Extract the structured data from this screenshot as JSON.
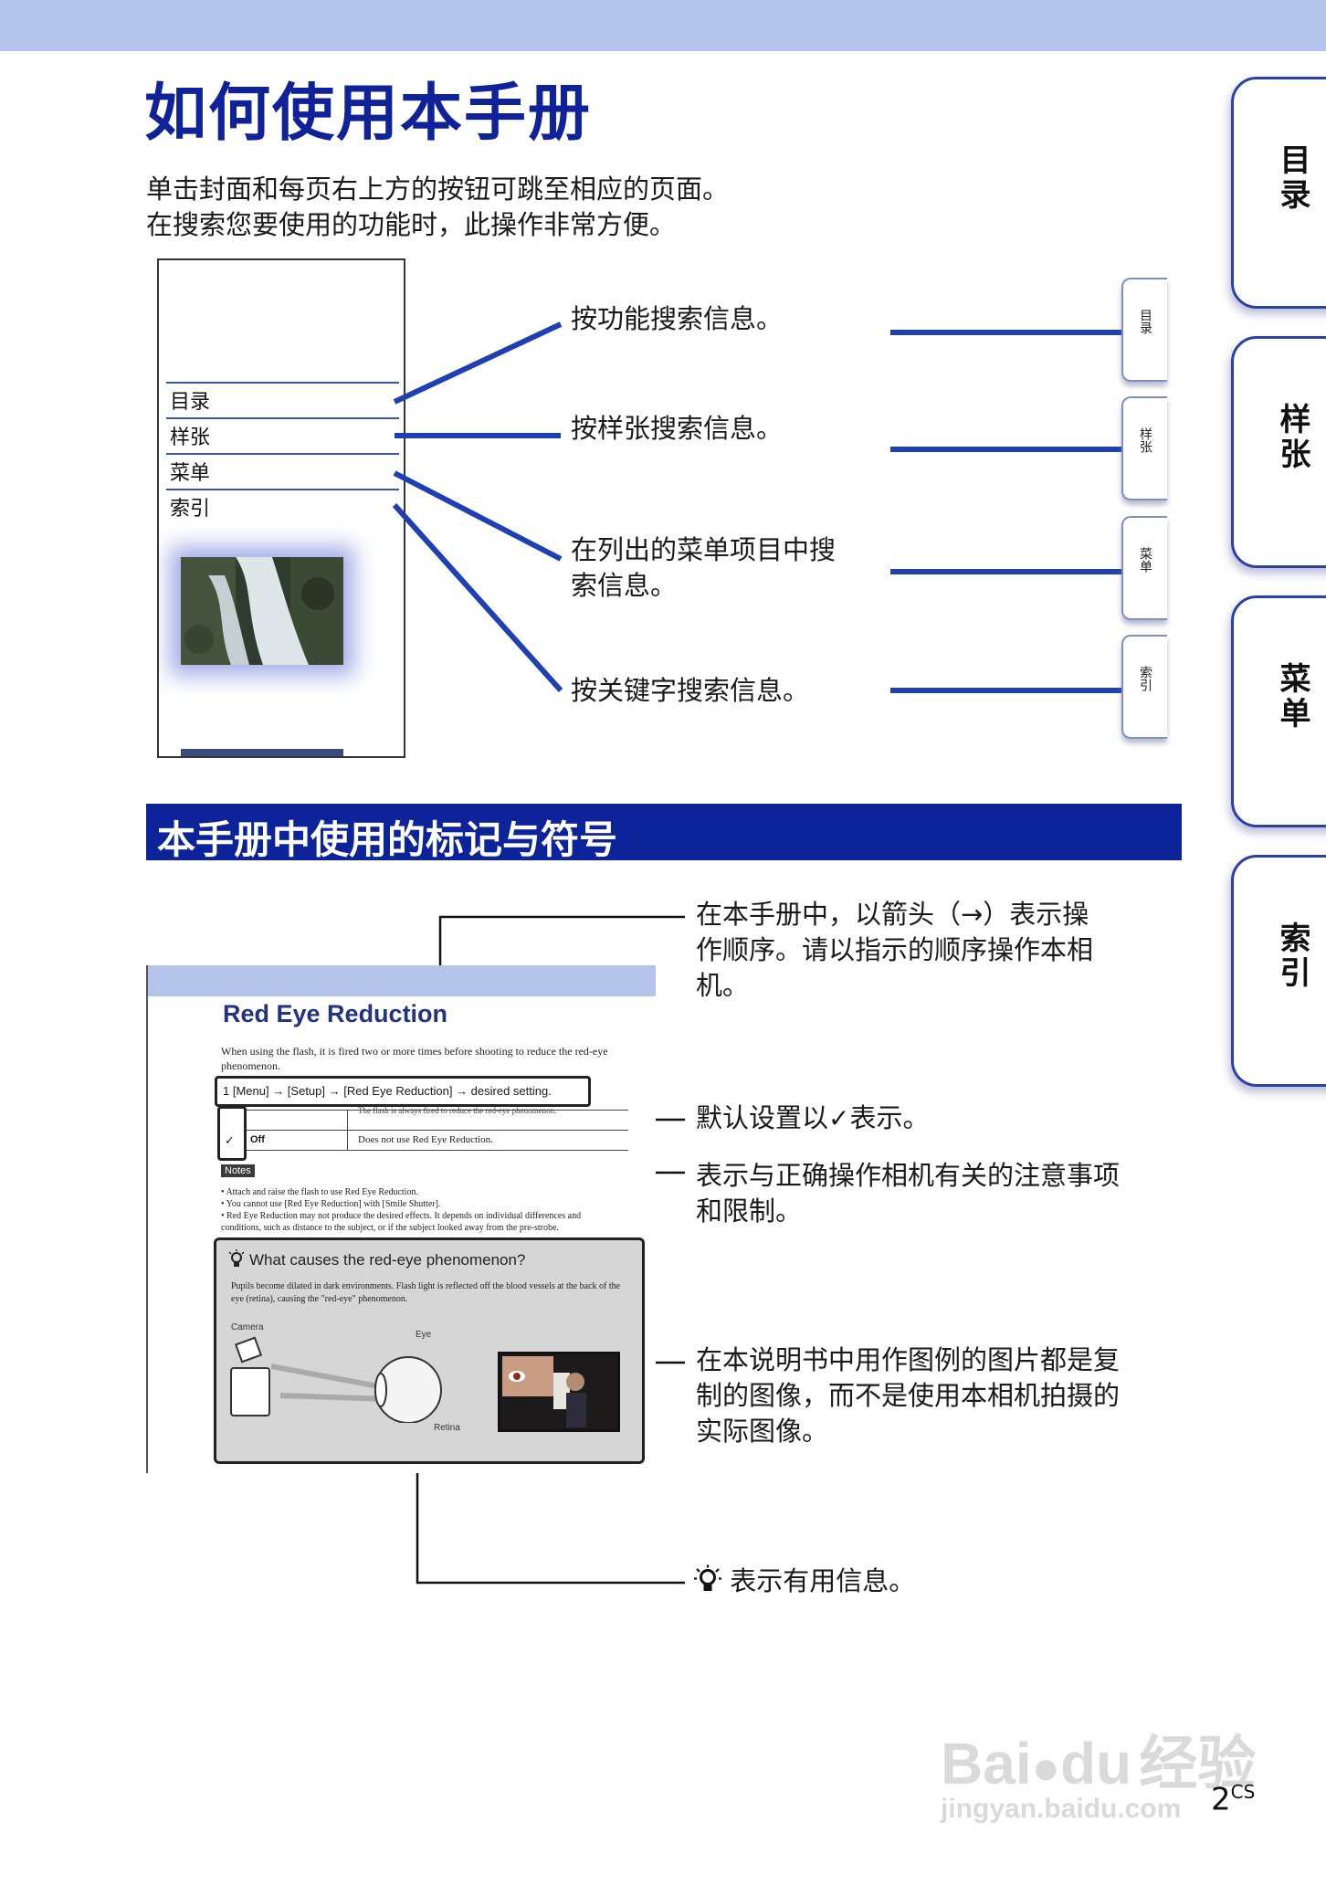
{
  "page": {
    "title": "如何使用本手册",
    "intro": [
      "单击封面和每页右上方的按钮可跳至相应的页面。",
      "在搜索您要使用的功能时，此操作非常方便。"
    ],
    "number": "2",
    "number_suffix": "CS"
  },
  "side_tabs": [
    "目录",
    "样张",
    "菜单",
    "索引"
  ],
  "diagram": {
    "page_items": [
      "目录",
      "样张",
      "菜单",
      "索引"
    ],
    "callouts": [
      "按功能搜索信息。",
      "按样张搜索信息。",
      "在列出的菜单项目中搜",
      "索信息。",
      "按关键字搜索信息。"
    ],
    "mini_tabs": [
      "目录",
      "样张",
      "菜单",
      "索引"
    ]
  },
  "section": {
    "title": "本手册中使用的标记与符号"
  },
  "sample_page": {
    "title": "Red Eye Reduction",
    "description": "When using the flash, it is fired two or more times before shooting to reduce the red-eye phenomenon.",
    "step": "1  [Menu] → [Setup] → [Red Eye Reduction] → desired setting.",
    "table_row1": "The flash is always fired to reduce the red-eye phenomenon.",
    "table_row2_key": "Off",
    "table_row2_value": "Does not use Red Eye Reduction.",
    "notes_badge": "Notes",
    "notes": [
      "• Attach and raise the flash to use Red Eye Reduction.",
      "• You cannot use [Red Eye Reduction] with [Smile Shutter].",
      "• Red Eye Reduction may not produce the desired effects. It depends on individual differences and",
      "  conditions, such as distance to the subject, or if the subject looked away from the pre-strobe."
    ],
    "tip_title": "What causes the red-eye phenomenon?",
    "tip_text": "Pupils become dilated in dark environments. Flash light is reflected off the blood vessels at the back of the eye (retina), causing the \"red-eye\" phenomenon.",
    "label_camera": "Camera",
    "label_eye": "Eye",
    "label_retina": "Retina"
  },
  "symbols": {
    "arrow_desc": [
      "在本手册中，以箭头（→）表示操",
      "作顺序。请以指示的顺序操作本相",
      "机。"
    ],
    "default_desc": [
      "默认设置以",
      "表示。"
    ],
    "notes_desc": [
      "表示与正确操作相机有关的注意事项",
      "和限制。"
    ],
    "image_desc": [
      "在本说明书中用作图例的图片都是复",
      "制的图像，而不是使用本相机拍摄的",
      "实际图像。"
    ],
    "tip_desc": "表示有用信息。"
  },
  "watermark": {
    "brand": "Bai",
    "brand2": "du",
    "brand_cn": "经验",
    "url": "jingyan.baidu.com"
  },
  "colors": {
    "title_blue": "#10229a",
    "header_band": "#b3c3ea",
    "line_blue": "#1f3fb5"
  }
}
